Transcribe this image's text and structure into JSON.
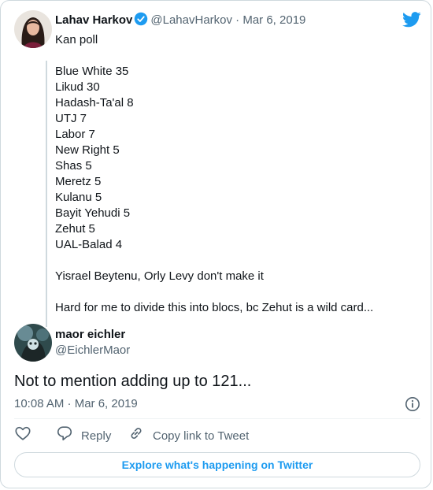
{
  "parent_tweet": {
    "author_name": "Lahav Harkov",
    "author_handle": "@LahavHarkov",
    "separator": "·",
    "date": "Mar 6, 2019",
    "lines": [
      "Kan poll",
      "",
      "Blue White 35",
      "Likud 30",
      "Hadash-Ta'al 8",
      "UTJ 7",
      "Labor 7",
      "New Right 5",
      "Shas 5",
      "Meretz 5",
      "Kulanu 5",
      "Bayit Yehudi 5",
      "Zehut 5",
      "UAL-Balad 4",
      "",
      "Yisrael Beytenu, Orly Levy don't make it",
      "",
      "Hard for me to divide this into blocs, bc Zehut is a wild card..."
    ]
  },
  "reply_tweet": {
    "author_name": "maor eichler",
    "author_handle": "@EichlerMaor",
    "text": "Not to mention adding up to 121...",
    "timestamp": "10:08 AM · Mar 6, 2019"
  },
  "actions": {
    "reply_label": "Reply",
    "copy_link_label": "Copy link to Tweet"
  },
  "explore_label": "Explore what's happening on Twitter",
  "colors": {
    "accent": "#1d9bf0",
    "text": "#0f1419",
    "muted": "#536471",
    "border": "#cfd9de"
  },
  "icons": [
    "verified-badge-icon",
    "twitter-bird-icon",
    "info-icon",
    "heart-icon",
    "reply-icon",
    "link-icon"
  ]
}
